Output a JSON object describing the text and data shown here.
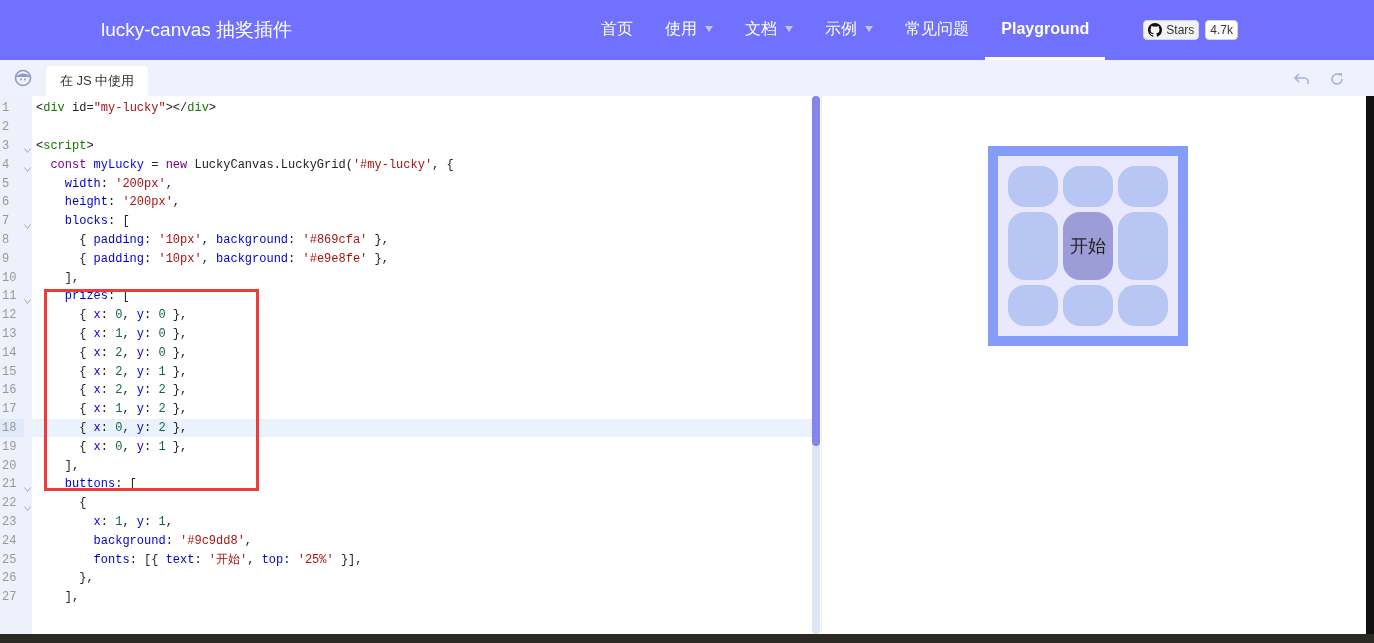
{
  "header": {
    "title": "lucky-canvas 抽奖插件",
    "nav": [
      {
        "label": "首页",
        "dropdown": false,
        "selected": false
      },
      {
        "label": "使用",
        "dropdown": true,
        "selected": false
      },
      {
        "label": "文档",
        "dropdown": true,
        "selected": false
      },
      {
        "label": "示例",
        "dropdown": true,
        "selected": false
      },
      {
        "label": "常见问题",
        "dropdown": false,
        "selected": false
      },
      {
        "label": "Playground",
        "dropdown": false,
        "selected": true
      }
    ],
    "github": {
      "label": "Stars",
      "count": "4.7k"
    }
  },
  "tabs": [
    {
      "label": "在 JS 中使用",
      "selected": true
    }
  ],
  "editor": {
    "lines": [
      {
        "number": "1",
        "foldable": false,
        "selected": false,
        "tokens": [
          {
            "kind": "plain",
            "text": "<"
          },
          {
            "kind": "tag",
            "text": "div"
          },
          {
            "kind": "plain",
            "text": " id="
          },
          {
            "kind": "str",
            "text": "\"my-lucky\""
          },
          {
            "kind": "plain",
            "text": "></"
          },
          {
            "kind": "tag",
            "text": "div"
          },
          {
            "kind": "plain",
            "text": ">"
          }
        ]
      },
      {
        "number": "2",
        "foldable": false,
        "selected": false
      },
      {
        "number": "3",
        "foldable": true,
        "selected": false,
        "tokens": [
          {
            "kind": "plain",
            "text": "<"
          },
          {
            "kind": "tag",
            "text": "script"
          },
          {
            "kind": "plain",
            "text": ">"
          }
        ]
      },
      {
        "number": "4",
        "foldable": true,
        "selected": false,
        "tokens": [
          {
            "kind": "kw",
            "text": "  const"
          },
          {
            "kind": "def",
            "text": " myLucky"
          },
          {
            "kind": "plain",
            "text": " = "
          },
          {
            "kind": "kw",
            "text": "new"
          },
          {
            "kind": "plain",
            "text": " LuckyCanvas.LuckyGrid("
          },
          {
            "kind": "str",
            "text": "'#my-lucky'"
          },
          {
            "kind": "plain",
            "text": ", {"
          }
        ]
      },
      {
        "number": "5",
        "foldable": false,
        "selected": false,
        "tokens": [
          {
            "kind": "prop",
            "text": "    width"
          },
          {
            "kind": "plain",
            "text": ": "
          },
          {
            "kind": "str",
            "text": "'200px'"
          },
          {
            "kind": "plain",
            "text": ","
          }
        ]
      },
      {
        "number": "6",
        "foldable": false,
        "selected": false,
        "tokens": [
          {
            "kind": "prop",
            "text": "    height"
          },
          {
            "kind": "plain",
            "text": ": "
          },
          {
            "kind": "str",
            "text": "'200px'"
          },
          {
            "kind": "plain",
            "text": ","
          }
        ]
      },
      {
        "number": "7",
        "foldable": true,
        "selected": false,
        "tokens": [
          {
            "kind": "prop",
            "text": "    blocks"
          },
          {
            "kind": "plain",
            "text": ": ["
          }
        ]
      },
      {
        "number": "8",
        "foldable": false,
        "selected": false,
        "tokens": [
          {
            "kind": "plain",
            "text": "      { "
          },
          {
            "kind": "prop",
            "text": "padding"
          },
          {
            "kind": "plain",
            "text": ": "
          },
          {
            "kind": "str",
            "text": "'10px'"
          },
          {
            "kind": "plain",
            "text": ", "
          },
          {
            "kind": "prop",
            "text": "background"
          },
          {
            "kind": "plain",
            "text": ": "
          },
          {
            "kind": "str",
            "text": "'#869cfa'"
          },
          {
            "kind": "plain",
            "text": " },"
          }
        ]
      },
      {
        "number": "9",
        "foldable": false,
        "selected": false,
        "tokens": [
          {
            "kind": "plain",
            "text": "      { "
          },
          {
            "kind": "prop",
            "text": "padding"
          },
          {
            "kind": "plain",
            "text": ": "
          },
          {
            "kind": "str",
            "text": "'10px'"
          },
          {
            "kind": "plain",
            "text": ", "
          },
          {
            "kind": "prop",
            "text": "background"
          },
          {
            "kind": "plain",
            "text": ": "
          },
          {
            "kind": "str",
            "text": "'#e9e8fe'"
          },
          {
            "kind": "plain",
            "text": " },"
          }
        ]
      },
      {
        "number": "10",
        "foldable": false,
        "selected": false,
        "tokens": [
          {
            "kind": "plain",
            "text": "    ],"
          }
        ]
      },
      {
        "number": "11",
        "foldable": true,
        "selected": false,
        "tokens": [
          {
            "kind": "prop",
            "text": "    prizes"
          },
          {
            "kind": "plain",
            "text": ": ["
          }
        ]
      },
      {
        "number": "12",
        "foldable": false,
        "selected": false,
        "tokens": [
          {
            "kind": "plain",
            "text": "      { "
          },
          {
            "kind": "prop",
            "text": "x"
          },
          {
            "kind": "plain",
            "text": ": "
          },
          {
            "kind": "num",
            "text": "0"
          },
          {
            "kind": "plain",
            "text": ", "
          },
          {
            "kind": "prop",
            "text": "y"
          },
          {
            "kind": "plain",
            "text": ": "
          },
          {
            "kind": "num",
            "text": "0"
          },
          {
            "kind": "plain",
            "text": " },"
          }
        ]
      },
      {
        "number": "13",
        "foldable": false,
        "selected": false,
        "tokens": [
          {
            "kind": "plain",
            "text": "      { "
          },
          {
            "kind": "prop",
            "text": "x"
          },
          {
            "kind": "plain",
            "text": ": "
          },
          {
            "kind": "num",
            "text": "1"
          },
          {
            "kind": "plain",
            "text": ", "
          },
          {
            "kind": "prop",
            "text": "y"
          },
          {
            "kind": "plain",
            "text": ": "
          },
          {
            "kind": "num",
            "text": "0"
          },
          {
            "kind": "plain",
            "text": " },"
          }
        ]
      },
      {
        "number": "14",
        "foldable": false,
        "selected": false,
        "tokens": [
          {
            "kind": "plain",
            "text": "      { "
          },
          {
            "kind": "prop",
            "text": "x"
          },
          {
            "kind": "plain",
            "text": ": "
          },
          {
            "kind": "num",
            "text": "2"
          },
          {
            "kind": "plain",
            "text": ", "
          },
          {
            "kind": "prop",
            "text": "y"
          },
          {
            "kind": "plain",
            "text": ": "
          },
          {
            "kind": "num",
            "text": "0"
          },
          {
            "kind": "plain",
            "text": " },"
          }
        ]
      },
      {
        "number": "15",
        "foldable": false,
        "selected": false,
        "tokens": [
          {
            "kind": "plain",
            "text": "      { "
          },
          {
            "kind": "prop",
            "text": "x"
          },
          {
            "kind": "plain",
            "text": ": "
          },
          {
            "kind": "num",
            "text": "2"
          },
          {
            "kind": "plain",
            "text": ", "
          },
          {
            "kind": "prop",
            "text": "y"
          },
          {
            "kind": "plain",
            "text": ": "
          },
          {
            "kind": "num",
            "text": "1"
          },
          {
            "kind": "plain",
            "text": " },"
          }
        ]
      },
      {
        "number": "16",
        "foldable": false,
        "selected": false,
        "tokens": [
          {
            "kind": "plain",
            "text": "      { "
          },
          {
            "kind": "prop",
            "text": "x"
          },
          {
            "kind": "plain",
            "text": ": "
          },
          {
            "kind": "num",
            "text": "2"
          },
          {
            "kind": "plain",
            "text": ", "
          },
          {
            "kind": "prop",
            "text": "y"
          },
          {
            "kind": "plain",
            "text": ": "
          },
          {
            "kind": "num",
            "text": "2"
          },
          {
            "kind": "plain",
            "text": " },"
          }
        ]
      },
      {
        "number": "17",
        "foldable": false,
        "selected": false,
        "tokens": [
          {
            "kind": "plain",
            "text": "      { "
          },
          {
            "kind": "prop",
            "text": "x"
          },
          {
            "kind": "plain",
            "text": ": "
          },
          {
            "kind": "num",
            "text": "1"
          },
          {
            "kind": "plain",
            "text": ", "
          },
          {
            "kind": "prop",
            "text": "y"
          },
          {
            "kind": "plain",
            "text": ": "
          },
          {
            "kind": "num",
            "text": "2"
          },
          {
            "kind": "plain",
            "text": " },"
          }
        ]
      },
      {
        "number": "18",
        "foldable": false,
        "selected": true,
        "tokens": [
          {
            "kind": "plain",
            "text": "      { "
          },
          {
            "kind": "prop",
            "text": "x"
          },
          {
            "kind": "plain",
            "text": ": "
          },
          {
            "kind": "num",
            "text": "0"
          },
          {
            "kind": "plain",
            "text": ", "
          },
          {
            "kind": "prop",
            "text": "y"
          },
          {
            "kind": "plain",
            "text": ": "
          },
          {
            "kind": "num",
            "text": "2"
          },
          {
            "kind": "plain",
            "text": " },"
          }
        ]
      },
      {
        "number": "19",
        "foldable": false,
        "selected": false,
        "tokens": [
          {
            "kind": "plain",
            "text": "      { "
          },
          {
            "kind": "prop",
            "text": "x"
          },
          {
            "kind": "plain",
            "text": ": "
          },
          {
            "kind": "num",
            "text": "0"
          },
          {
            "kind": "plain",
            "text": ", "
          },
          {
            "kind": "prop",
            "text": "y"
          },
          {
            "kind": "plain",
            "text": ": "
          },
          {
            "kind": "num",
            "text": "1"
          },
          {
            "kind": "plain",
            "text": " },"
          }
        ]
      },
      {
        "number": "20",
        "foldable": false,
        "selected": false,
        "tokens": [
          {
            "kind": "plain",
            "text": "    ],"
          }
        ]
      },
      {
        "number": "21",
        "foldable": true,
        "selected": false,
        "tokens": [
          {
            "kind": "prop",
            "text": "    buttons"
          },
          {
            "kind": "plain",
            "text": ": ["
          }
        ]
      },
      {
        "number": "22",
        "foldable": true,
        "selected": false,
        "tokens": [
          {
            "kind": "plain",
            "text": "      {"
          }
        ]
      },
      {
        "number": "23",
        "foldable": false,
        "selected": false,
        "tokens": [
          {
            "kind": "prop",
            "text": "        x"
          },
          {
            "kind": "plain",
            "text": ": "
          },
          {
            "kind": "num",
            "text": "1"
          },
          {
            "kind": "plain",
            "text": ", "
          },
          {
            "kind": "prop",
            "text": "y"
          },
          {
            "kind": "plain",
            "text": ": "
          },
          {
            "kind": "num",
            "text": "1"
          },
          {
            "kind": "plain",
            "text": ","
          }
        ]
      },
      {
        "number": "24",
        "foldable": false,
        "selected": false,
        "tokens": [
          {
            "kind": "prop",
            "text": "        background"
          },
          {
            "kind": "plain",
            "text": ": "
          },
          {
            "kind": "str",
            "text": "'#9c9dd8'"
          },
          {
            "kind": "plain",
            "text": ","
          }
        ]
      },
      {
        "number": "25",
        "foldable": false,
        "selected": false,
        "tokens": [
          {
            "kind": "prop",
            "text": "        fonts"
          },
          {
            "kind": "plain",
            "text": ": [{ "
          },
          {
            "kind": "prop",
            "text": "text"
          },
          {
            "kind": "plain",
            "text": ": "
          },
          {
            "kind": "str",
            "text": "'开始'"
          },
          {
            "kind": "plain",
            "text": ", "
          },
          {
            "kind": "prop",
            "text": "top"
          },
          {
            "kind": "plain",
            "text": ": "
          },
          {
            "kind": "str",
            "text": "'25%'"
          },
          {
            "kind": "plain",
            "text": " }],"
          }
        ]
      },
      {
        "number": "26",
        "foldable": false,
        "selected": false,
        "tokens": [
          {
            "kind": "plain",
            "text": "      },"
          }
        ]
      },
      {
        "number": "27",
        "foldable": false,
        "selected": false,
        "tokens": [
          {
            "kind": "plain",
            "text": "    ],"
          }
        ]
      }
    ]
  },
  "preview": {
    "button_text": "开始"
  }
}
